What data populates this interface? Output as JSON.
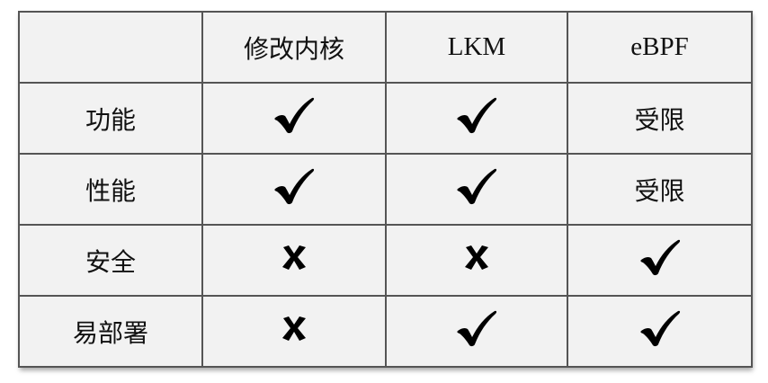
{
  "table": {
    "headers": [
      "",
      "修改内核",
      "LKM",
      "eBPF"
    ],
    "rows": [
      {
        "label": "功能",
        "cells": [
          {
            "kind": "icon",
            "icon": "check-icon"
          },
          {
            "kind": "icon",
            "icon": "check-icon"
          },
          {
            "kind": "text",
            "text": "受限"
          }
        ]
      },
      {
        "label": "性能",
        "cells": [
          {
            "kind": "icon",
            "icon": "check-icon"
          },
          {
            "kind": "icon",
            "icon": "check-icon"
          },
          {
            "kind": "text",
            "text": "受限"
          }
        ]
      },
      {
        "label": "安全",
        "cells": [
          {
            "kind": "icon",
            "icon": "cross-icon"
          },
          {
            "kind": "icon",
            "icon": "cross-icon"
          },
          {
            "kind": "icon",
            "icon": "check-icon"
          }
        ]
      },
      {
        "label": "易部署",
        "cells": [
          {
            "kind": "icon",
            "icon": "cross-icon"
          },
          {
            "kind": "icon",
            "icon": "check-icon"
          },
          {
            "kind": "icon",
            "icon": "check-icon"
          }
        ]
      }
    ]
  }
}
